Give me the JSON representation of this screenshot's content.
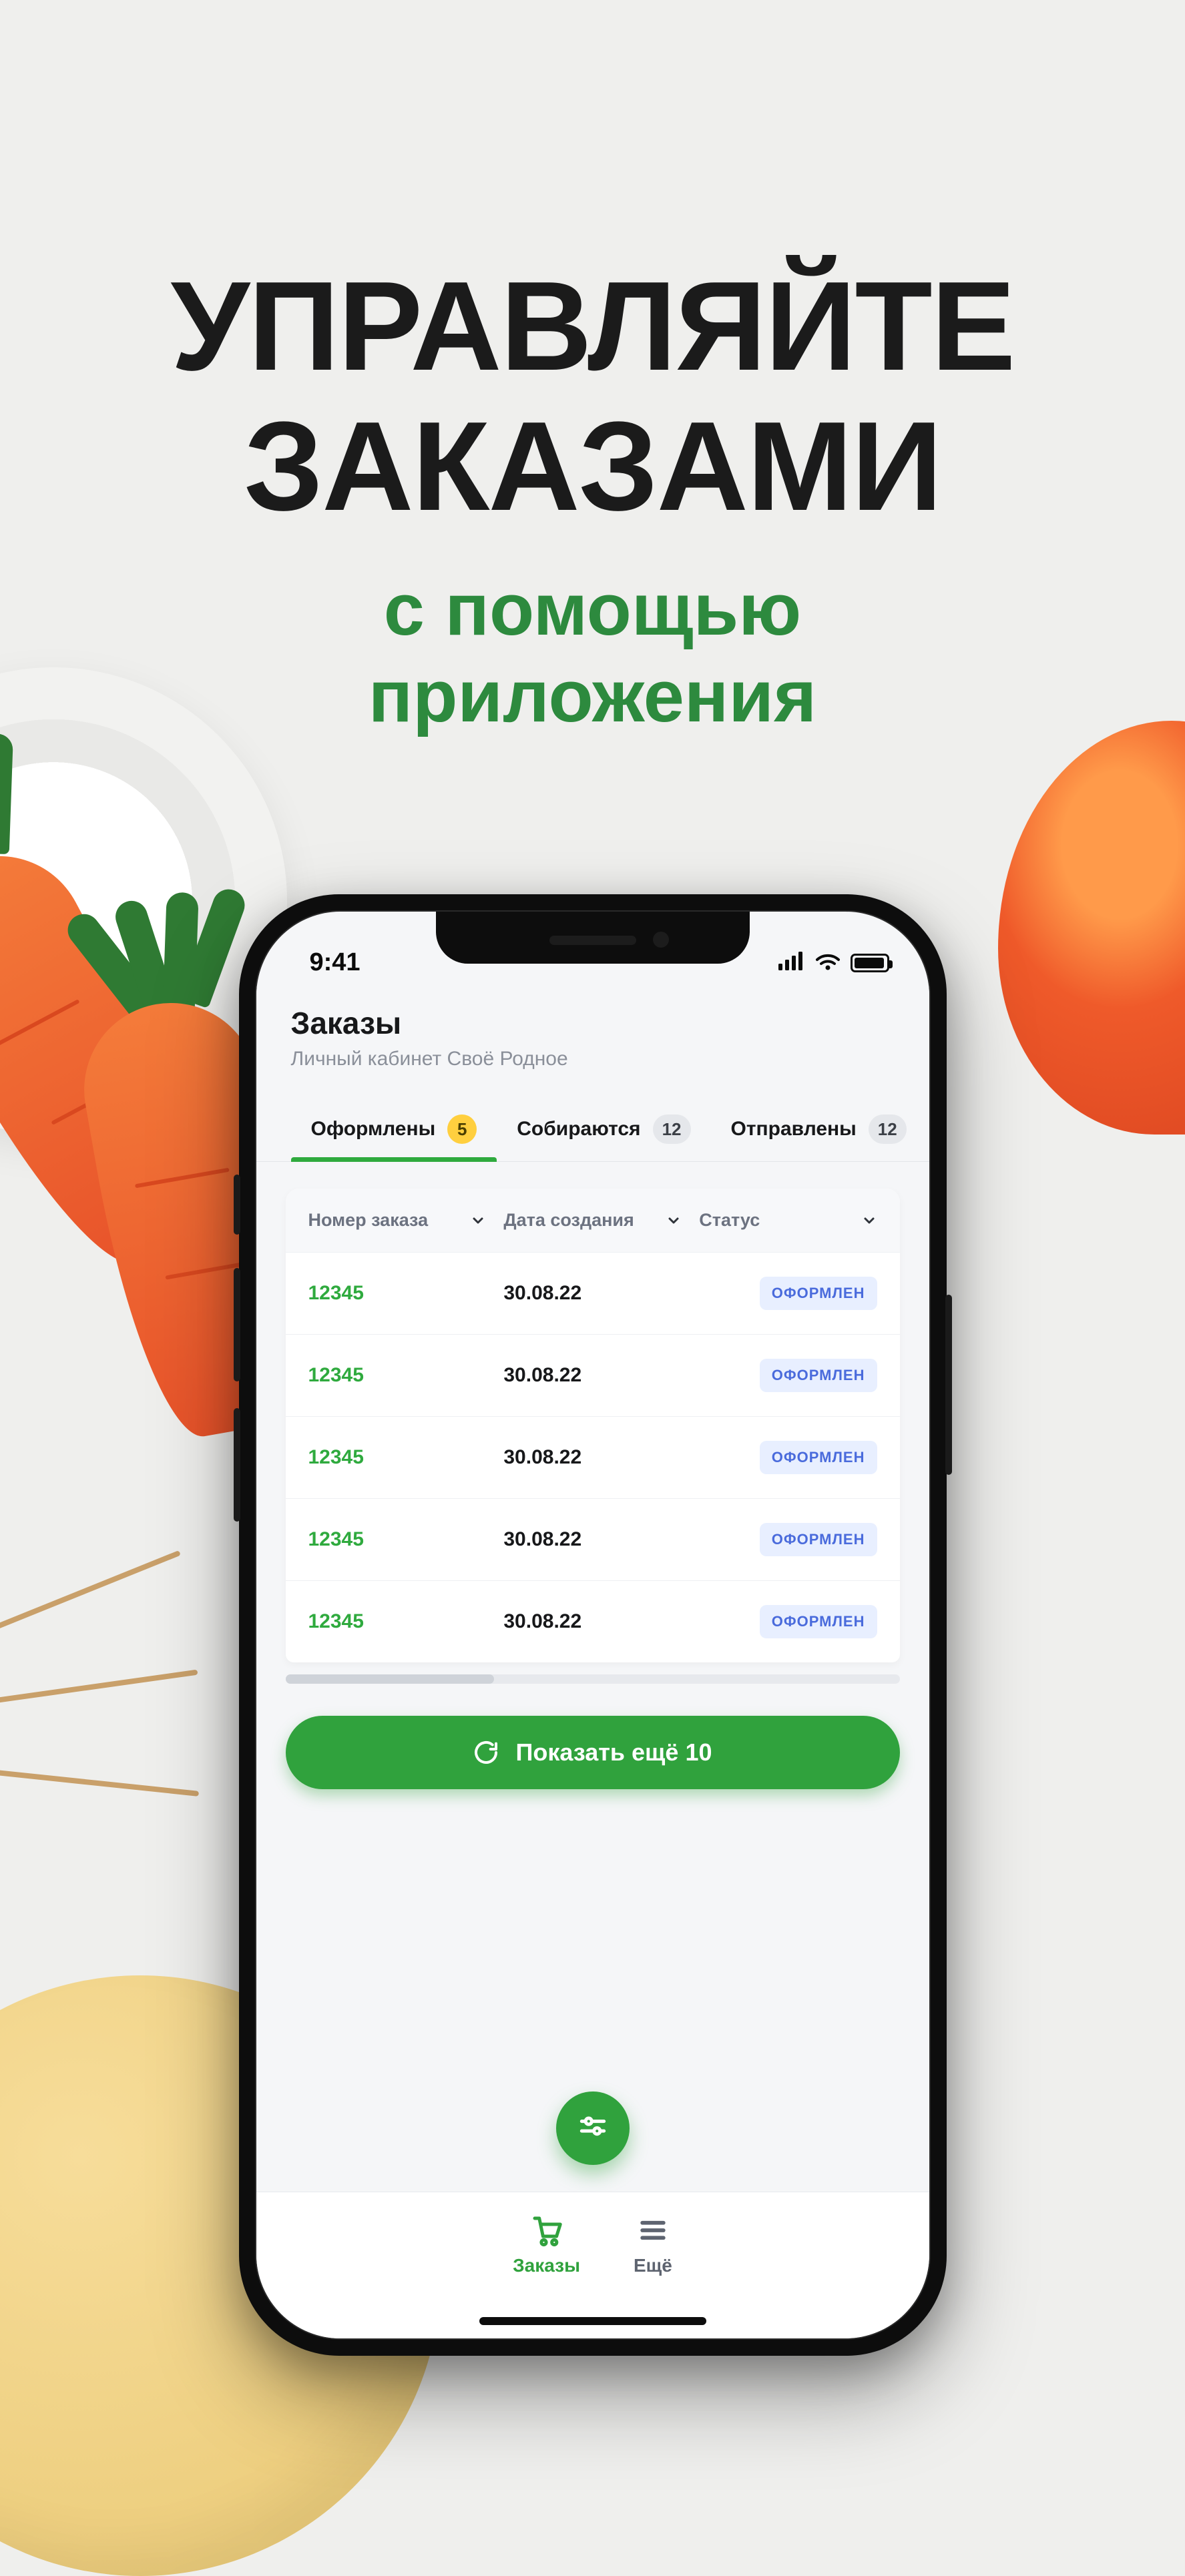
{
  "marketing": {
    "headline_line1": "УПРАВЛЯЙТЕ",
    "headline_line2": "ЗАКАЗАМИ",
    "subheadline_line1": "с помощью",
    "subheadline_line2": "приложения"
  },
  "status_bar": {
    "time": "9:41"
  },
  "header": {
    "title": "Заказы",
    "subtitle": "Личный кабинет Своё Родное"
  },
  "tabs": [
    {
      "label": "Оформлены",
      "count": "5",
      "badge_style": "warn",
      "active": true
    },
    {
      "label": "Собираются",
      "count": "12",
      "badge_style": "gray",
      "active": false
    },
    {
      "label": "Отправлены",
      "count": "12",
      "badge_style": "gray",
      "active": false
    }
  ],
  "table": {
    "columns": [
      {
        "label": "Номер заказа"
      },
      {
        "label": "Дата создания"
      },
      {
        "label": "Статус"
      }
    ],
    "rows": [
      {
        "number": "12345",
        "date": "30.08.22",
        "status": "ОФОРМЛЕН"
      },
      {
        "number": "12345",
        "date": "30.08.22",
        "status": "ОФОРМЛЕН"
      },
      {
        "number": "12345",
        "date": "30.08.22",
        "status": "ОФОРМЛЕН"
      },
      {
        "number": "12345",
        "date": "30.08.22",
        "status": "ОФОРМЛЕН"
      },
      {
        "number": "12345",
        "date": "30.08.22",
        "status": "ОФОРМЛЕН"
      }
    ]
  },
  "show_more": {
    "label": "Показать ещё 10"
  },
  "bottom_nav": {
    "orders": "Заказы",
    "more": "Ещё"
  }
}
